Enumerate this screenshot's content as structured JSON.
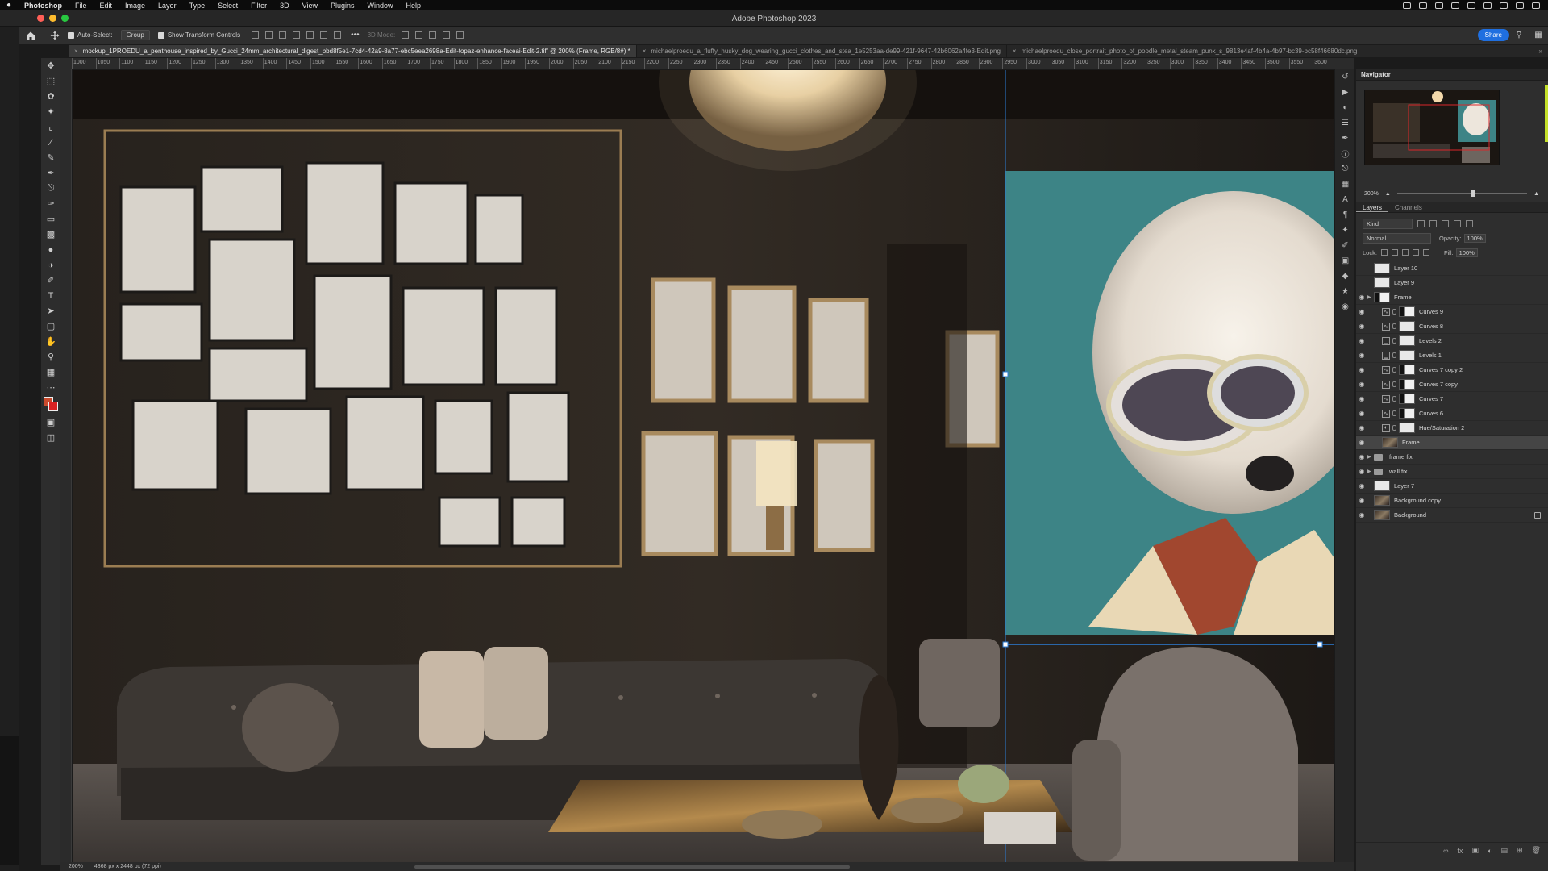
{
  "menubar": {
    "app_name": "Photoshop",
    "items": [
      "File",
      "Edit",
      "Image",
      "Layer",
      "Type",
      "Select",
      "Filter",
      "3D",
      "View",
      "Plugins",
      "Window",
      "Help"
    ]
  },
  "window": {
    "title": "Adobe Photoshop 2023"
  },
  "options": {
    "auto_select_label": "Auto-Select:",
    "auto_select_value": "Group",
    "transform_label": "Show Transform Controls",
    "mode3d_label": "3D Mode:",
    "share_label": "Share"
  },
  "tabs": [
    {
      "label": "mockup_1PROEDU_a_penthouse_inspired_by_Gucci_24mm_architectural_digest_bbd8f5e1-7cd4-42a9-8a77-ebc5eea2698a-Edit-topaz-enhance-faceai-Edit-2.tiff @ 200% (Frame, RGB/8#) *"
    },
    {
      "label": "michaelproedu_a_fluffy_husky_dog_wearing_gucci_clothes_and_stea_1e5253aa-de99-421f-9647-42b6062a4fe3-Edit.png"
    },
    {
      "label": "michaelproedu_close_portrait_photo_of_poodle_metal_steam_punk_s_9813e4af-4b4a-4b97-bc39-bc58f46680dc.png"
    }
  ],
  "tabs_more": "»",
  "ruler_ticks": [
    "1000",
    "1050",
    "1100",
    "1150",
    "1200",
    "1250",
    "1300",
    "1350",
    "1400",
    "1450",
    "1500",
    "1550",
    "1600",
    "1650",
    "1700",
    "1750",
    "1800",
    "1850",
    "1900",
    "1950",
    "2000",
    "2050",
    "2100",
    "2150",
    "2200",
    "2250",
    "2300",
    "2350",
    "2400",
    "2450",
    "2500",
    "2550",
    "2600",
    "2650",
    "2700",
    "2750",
    "2800",
    "2850",
    "2900",
    "2950",
    "3000",
    "3050",
    "3100",
    "3150",
    "3200",
    "3250",
    "3300",
    "3350",
    "3400",
    "3450",
    "3500",
    "3550",
    "3600"
  ],
  "statusbar": {
    "zoom": "200%",
    "doc_size": "4368 px x 2448 px (72 ppi)"
  },
  "panels": {
    "navigator": {
      "title": "Navigator",
      "zoom": "200%"
    },
    "layers": {
      "tabs": [
        "Layers",
        "Channels"
      ],
      "kind": "Kind",
      "blend_mode": "Normal",
      "opacity_label": "Opacity:",
      "opacity_value": "100%",
      "lock_label": "Lock:",
      "fill_label": "Fill:",
      "fill_value": "100%",
      "rows": [
        {
          "name": "Layer 10",
          "visible": false,
          "indent": 0,
          "thumb": "white"
        },
        {
          "name": "Layer 9",
          "visible": false,
          "indent": 0,
          "thumb": "white"
        },
        {
          "name": "Frame",
          "visible": true,
          "indent": 0,
          "thumb": "group-mask",
          "group": true
        },
        {
          "name": "Curves 9",
          "visible": true,
          "indent": 1,
          "thumb": "dark",
          "adj": "curves"
        },
        {
          "name": "Curves 8",
          "visible": true,
          "indent": 1,
          "thumb": "white",
          "adj": "curves"
        },
        {
          "name": "Levels 2",
          "visible": true,
          "indent": 1,
          "thumb": "white",
          "adj": "levels"
        },
        {
          "name": "Levels 1",
          "visible": true,
          "indent": 1,
          "thumb": "white",
          "adj": "levels"
        },
        {
          "name": "Curves 7 copy 2",
          "visible": true,
          "indent": 1,
          "thumb": "dark",
          "adj": "curves"
        },
        {
          "name": "Curves 7 copy",
          "visible": true,
          "indent": 1,
          "thumb": "dark",
          "adj": "curves"
        },
        {
          "name": "Curves 7",
          "visible": true,
          "indent": 1,
          "thumb": "dark",
          "adj": "curves"
        },
        {
          "name": "Curves 6",
          "visible": true,
          "indent": 1,
          "thumb": "dark",
          "adj": "curves"
        },
        {
          "name": "Hue/Saturation 2",
          "visible": true,
          "indent": 1,
          "thumb": "white",
          "adj": "hue"
        },
        {
          "name": "Frame",
          "visible": true,
          "indent": 1,
          "thumb": "smart",
          "selected": true
        },
        {
          "name": "frame fix",
          "visible": true,
          "indent": 0,
          "thumb": "folder",
          "group": true
        },
        {
          "name": "wall fix",
          "visible": true,
          "indent": 0,
          "thumb": "folder",
          "group": true
        },
        {
          "name": "Layer 7",
          "visible": true,
          "indent": 0,
          "thumb": "white"
        },
        {
          "name": "Background copy",
          "visible": true,
          "indent": 0,
          "thumb": "photo"
        },
        {
          "name": "Background",
          "visible": true,
          "indent": 0,
          "thumb": "photo",
          "locked": true
        }
      ]
    }
  },
  "colors": {
    "foreground": "#c9492c",
    "background": "#d82122",
    "accent": "#1f6fe0",
    "poodle_backdrop": "#3d8486"
  }
}
